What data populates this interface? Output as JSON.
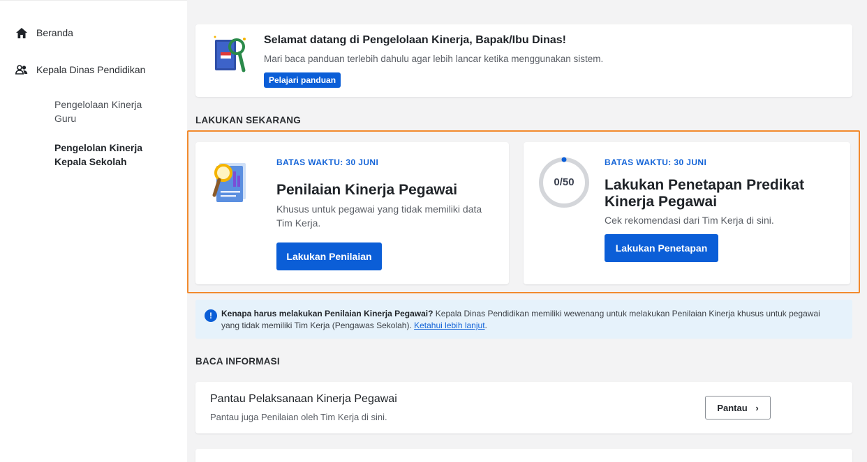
{
  "sidebar": {
    "home_label": "Beranda",
    "role_label": "Kepala Dinas Pendidikan",
    "sub_items": [
      {
        "label": "Pengelolaan Kinerja Guru"
      },
      {
        "label": "Pengelolan Kinerja Kepala Sekolah"
      }
    ]
  },
  "welcome": {
    "title": "Selamat datang di Pengelolaan Kinerja, Bapak/Ibu Dinas!",
    "subtitle": "Mari baca panduan terlebih dahulu agar lebih lancar ketika menggunakan sistem.",
    "button": "Pelajari panduan"
  },
  "todo_section": "LAKUKAN SEKARANG",
  "tasks": [
    {
      "deadline": "BATAS WAKTU: 30 JUNI",
      "title": "Penilaian Kinerja Pegawai",
      "desc": "Khusus untuk pegawai yang tidak memiliki data Tim Kerja.",
      "button": "Lakukan Penilaian"
    },
    {
      "deadline": "BATAS WAKTU: 30 JUNI",
      "title": "Lakukan Penetapan Predikat Kinerja Pegawai",
      "desc": "Cek rekomendasi dari Tim Kerja di sini.",
      "button": "Lakukan Penetapan",
      "progress_label": "0/50",
      "progress_done": 0,
      "progress_total": 50
    }
  ],
  "info": {
    "question": "Kenapa harus melakukan Penilaian Kinerja Pegawai?",
    "text": " Kepala Dinas Pendidikan memiliki wewenang untuk melakukan Penilaian Kinerja khusus untuk pegawai yang tidak memiliki Tim Kerja (Pengawas Sekolah). ",
    "link": "Ketahui lebih lanjut",
    "end": "."
  },
  "read_section": "BACA INFORMASI",
  "read_card": {
    "title": "Pantau Pelaksanaan Kinerja Pegawai",
    "subtitle": "Pantau juga Penilaian oleh Tim Kerja di sini.",
    "button": "Pantau"
  },
  "colors": {
    "primary": "#0b5ed7",
    "highlight": "#f28a2d",
    "info_bg": "#e6f2fb"
  }
}
